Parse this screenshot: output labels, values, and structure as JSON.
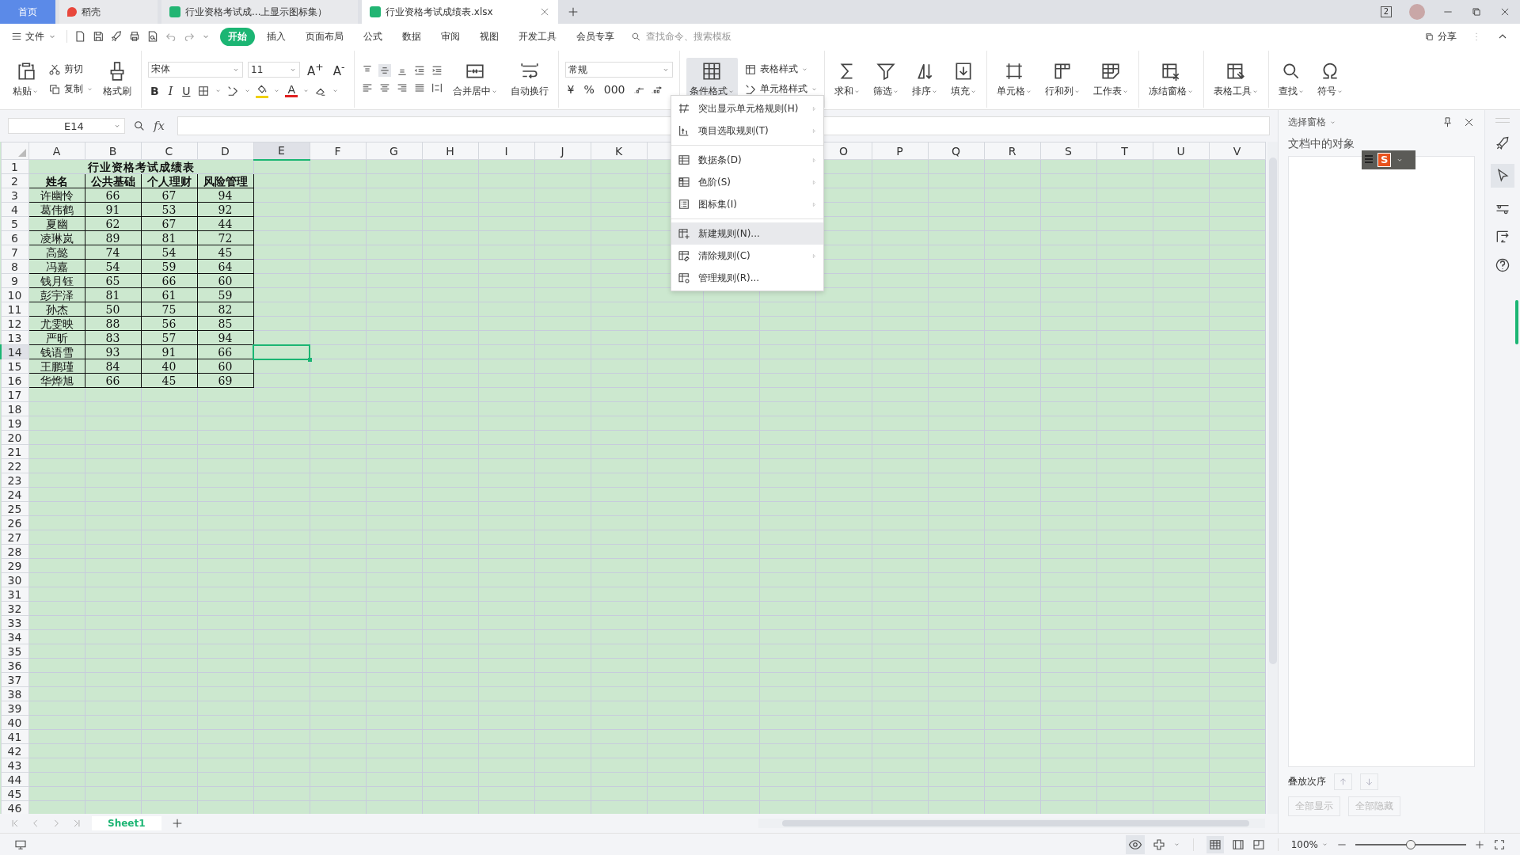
{
  "title_bar": {
    "window_count": "2"
  },
  "tabs": [
    {
      "label": "首页",
      "kind": "home",
      "selected": false
    },
    {
      "label": "稻壳",
      "kind": "docer",
      "selected": false
    },
    {
      "label": "行业资格考试成...上显示图标集）",
      "kind": "sheet",
      "selected": false
    },
    {
      "label": "行业资格考试成绩表.xlsx",
      "kind": "sheet",
      "selected": true
    }
  ],
  "menu_bar": {
    "file": "文件",
    "tabs": [
      {
        "label": "开始",
        "selected": true
      },
      {
        "label": "插入",
        "selected": false
      },
      {
        "label": "页面布局",
        "selected": false
      },
      {
        "label": "公式",
        "selected": false
      },
      {
        "label": "数据",
        "selected": false
      },
      {
        "label": "审阅",
        "selected": false
      },
      {
        "label": "视图",
        "selected": false
      },
      {
        "label": "开发工具",
        "selected": false
      },
      {
        "label": "会员专享",
        "selected": false
      }
    ],
    "search": {
      "placeholder": "查找命令、搜索模板"
    },
    "share": "分享"
  },
  "ribbon": {
    "paste": "粘贴",
    "cut": "剪切",
    "copy": "复制",
    "painter": "格式刷",
    "font": "宋体",
    "size": "11",
    "grow": "A$^{+}$",
    "shrink": "A$^{-}$",
    "styles": [
      "B",
      "I",
      "U"
    ],
    "font_color": "A",
    "merge": "合并居中",
    "wrap": "自动换行",
    "number_format": "常规",
    "number_symbols": [
      "¥",
      "%",
      "000"
    ],
    "conditional": {
      "label": "条件格式",
      "pressed": true
    },
    "table_styles": [
      "表格样式",
      "单元格样式"
    ],
    "large_groups": [
      [
        "求和",
        "筛选",
        "排序",
        "填充"
      ],
      [
        "单元格",
        "行和列",
        "工作表"
      ],
      [
        "冻结窗格"
      ],
      [
        "表格工具"
      ],
      [
        "查找",
        "符号"
      ]
    ]
  },
  "formula_bar": {
    "cell": "E14",
    "fx": "fx"
  },
  "sheet": {
    "columns": [
      {
        "label": "A",
        "selected": false
      },
      {
        "label": "B",
        "selected": false
      },
      {
        "label": "C",
        "selected": false
      },
      {
        "label": "D",
        "selected": false
      },
      {
        "label": "E",
        "selected": true
      },
      {
        "label": "F",
        "selected": false
      },
      {
        "label": "G",
        "selected": false
      },
      {
        "label": "H",
        "selected": false
      },
      {
        "label": "I",
        "selected": false
      },
      {
        "label": "J",
        "selected": false
      },
      {
        "label": "K",
        "selected": false
      },
      {},
      {},
      {},
      {
        "label": "O",
        "selected": false
      },
      {
        "label": "P",
        "selected": false
      },
      {
        "label": "Q",
        "selected": false
      },
      {
        "label": "R",
        "selected": false
      },
      {
        "label": "S",
        "selected": false
      },
      {
        "label": "T",
        "selected": false
      },
      {
        "label": "U",
        "selected": false
      },
      {
        "label": "V",
        "selected": false
      }
    ],
    "rows": [
      {
        "label": "1",
        "kind": "title",
        "selected": false,
        "cells": [
          "行业资格考试成绩表"
        ]
      },
      {
        "label": "2",
        "kind": "header",
        "selected": false,
        "cells": [
          "姓名",
          "公共基础",
          "个人理财",
          "风险管理"
        ]
      },
      {
        "label": "3",
        "kind": "data",
        "selected": false,
        "cells": [
          "许幽怜",
          "66",
          "67",
          "94"
        ]
      },
      {
        "label": "4",
        "kind": "data",
        "selected": false,
        "cells": [
          "葛伟鹤",
          "91",
          "53",
          "92"
        ]
      },
      {
        "label": "5",
        "kind": "data",
        "selected": false,
        "cells": [
          "夏幽",
          "62",
          "67",
          "44"
        ]
      },
      {
        "label": "6",
        "kind": "data",
        "selected": false,
        "cells": [
          "凌琳岚",
          "89",
          "81",
          "72"
        ]
      },
      {
        "label": "7",
        "kind": "data",
        "selected": false,
        "cells": [
          "高懿",
          "74",
          "54",
          "45"
        ]
      },
      {
        "label": "8",
        "kind": "data",
        "selected": false,
        "cells": [
          "冯嘉",
          "54",
          "59",
          "64"
        ]
      },
      {
        "label": "9",
        "kind": "data",
        "selected": false,
        "cells": [
          "钱月钰",
          "65",
          "66",
          "60"
        ]
      },
      {
        "label": "10",
        "kind": "data",
        "selected": false,
        "cells": [
          "彭宇泽",
          "81",
          "61",
          "59"
        ]
      },
      {
        "label": "11",
        "kind": "data",
        "selected": false,
        "cells": [
          "孙杰",
          "50",
          "75",
          "82"
        ]
      },
      {
        "label": "12",
        "kind": "data",
        "selected": false,
        "cells": [
          "尤雯映",
          "88",
          "56",
          "85"
        ]
      },
      {
        "label": "13",
        "kind": "data",
        "selected": false,
        "cells": [
          "严昕",
          "83",
          "57",
          "94"
        ]
      },
      {
        "label": "14",
        "kind": "data",
        "selected": true,
        "cells": [
          "钱语雪",
          "93",
          "91",
          "66"
        ]
      },
      {
        "label": "15",
        "kind": "data",
        "selected": false,
        "cells": [
          "王鹏瑾",
          "84",
          "40",
          "60"
        ]
      },
      {
        "label": "16",
        "kind": "data",
        "selected": false,
        "cells": [
          "华烨旭",
          "66",
          "45",
          "69"
        ]
      },
      {
        "label": "17",
        "kind": "empty",
        "selected": false
      },
      {
        "label": "18",
        "kind": "empty",
        "selected": false
      },
      {
        "label": "19",
        "kind": "empty",
        "selected": false
      },
      {
        "label": "20",
        "kind": "empty",
        "selected": false
      },
      {
        "label": "21",
        "kind": "empty",
        "selected": false
      },
      {
        "label": "22",
        "kind": "empty",
        "selected": false
      },
      {
        "label": "23",
        "kind": "empty",
        "selected": false
      },
      {
        "label": "24",
        "kind": "empty",
        "selected": false
      },
      {
        "label": "25",
        "kind": "empty",
        "selected": false
      },
      {
        "label": "26",
        "kind": "empty",
        "selected": false
      },
      {
        "label": "27",
        "kind": "empty",
        "selected": false
      },
      {
        "label": "28",
        "kind": "empty",
        "selected": false
      },
      {
        "label": "29",
        "kind": "empty",
        "selected": false
      },
      {
        "label": "30",
        "kind": "empty",
        "selected": false
      },
      {
        "label": "31",
        "kind": "empty",
        "selected": false
      },
      {
        "label": "32",
        "kind": "empty",
        "selected": false
      },
      {
        "label": "33",
        "kind": "empty",
        "selected": false
      },
      {
        "label": "34",
        "kind": "empty",
        "selected": false
      },
      {
        "label": "35",
        "kind": "empty",
        "selected": false
      },
      {
        "label": "36",
        "kind": "empty",
        "selected": false
      },
      {
        "label": "37",
        "kind": "empty",
        "selected": false
      },
      {
        "label": "38",
        "kind": "empty",
        "selected": false
      },
      {
        "label": "39",
        "kind": "empty",
        "selected": false
      },
      {
        "label": "40",
        "kind": "empty",
        "selected": false
      },
      {
        "label": "41",
        "kind": "empty",
        "selected": false
      },
      {
        "label": "42",
        "kind": "empty",
        "selected": false
      },
      {
        "label": "43",
        "kind": "empty",
        "selected": false
      },
      {
        "label": "44",
        "kind": "empty",
        "selected": false
      },
      {
        "label": "45",
        "kind": "empty",
        "selected": false
      },
      {
        "label": "46",
        "kind": "empty",
        "selected": false
      }
    ]
  },
  "context_menu": {
    "groups": [
      [
        {
          "label": "突出显示单元格规则(H)",
          "submenu": true,
          "selected": false
        },
        {
          "label": "项目选取规则(T)",
          "submenu": true,
          "selected": false
        }
      ],
      [
        {
          "label": "数据条(D)",
          "submenu": true,
          "selected": false
        },
        {
          "label": "色阶(S)",
          "submenu": true,
          "selected": false
        },
        {
          "label": "图标集(I)",
          "submenu": true,
          "selected": false
        }
      ],
      [
        {
          "label": "新建规则(N)...",
          "submenu": false,
          "selected": true
        },
        {
          "label": "清除规则(C)",
          "submenu": true,
          "selected": false
        },
        {
          "label": "管理规则(R)...",
          "submenu": false,
          "selected": false
        }
      ]
    ]
  },
  "ime_toolbar": {
    "logo": "S"
  },
  "selection_pane": {
    "title": "选择窗格",
    "heading": "文档中的对象",
    "order_label": "叠放次序",
    "buttons": [
      {
        "label": "全部显示",
        "disabled": true
      },
      {
        "label": "全部隐藏",
        "disabled": true
      }
    ]
  },
  "sheet_tabs": [
    {
      "label": "Sheet1",
      "selected": true
    }
  ],
  "status_bar": {
    "zoom": "100%",
    "zoom_slider": {
      "level": 0.5
    }
  }
}
